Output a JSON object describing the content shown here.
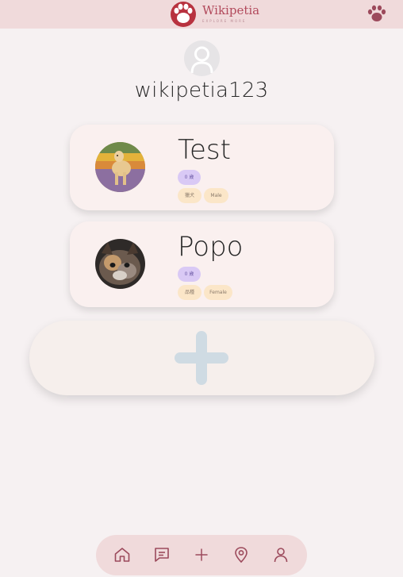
{
  "header": {
    "brand_name": "Wikipetia",
    "brand_tagline": "EXPLORE MORE"
  },
  "profile": {
    "username": "wikipetia123"
  },
  "pets": [
    {
      "name": "Test",
      "age": "0 歲",
      "breed": "獵犬",
      "gender": "Male"
    },
    {
      "name": "Popo",
      "age": "0 歲",
      "breed": "品種",
      "gender": "Female"
    }
  ],
  "icons": {
    "logo": "paw-logo-icon",
    "top_right": "paw-icon",
    "avatar": "user-placeholder-icon",
    "add": "plus-icon",
    "nav": [
      "home-icon",
      "chat-icon",
      "plus-icon",
      "location-pin-icon",
      "user-icon"
    ]
  },
  "colors": {
    "topbar": "#f0dadb",
    "background": "#f6f1f2",
    "brand": "#b24a5c",
    "card": "#faf0ef",
    "age_chip": "#d9c9f5",
    "info_chip": "#fbe6c8",
    "add_plus": "#cfdbe3",
    "nav_icon": "#9c4a5c"
  }
}
